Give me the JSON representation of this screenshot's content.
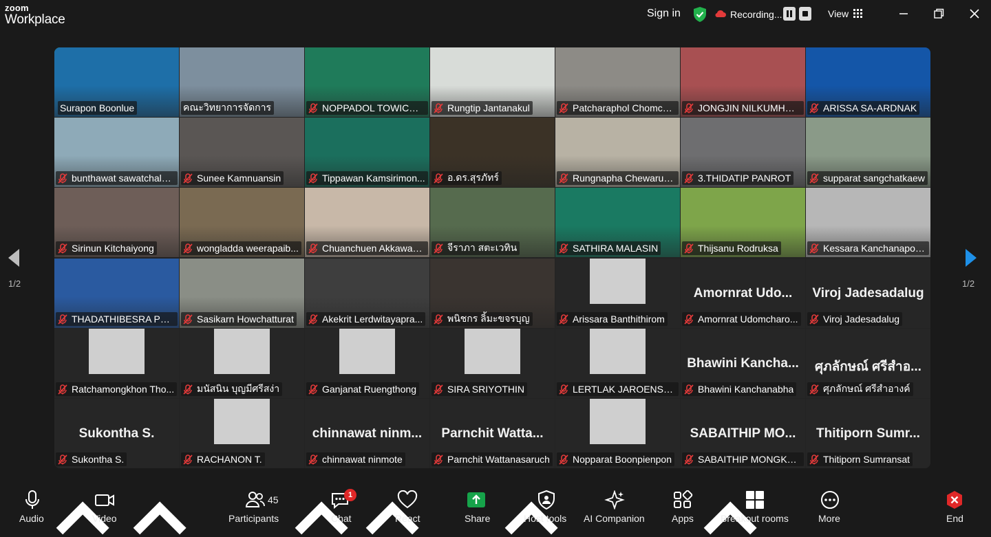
{
  "app": {
    "brand_top": "zoom",
    "brand_bottom": "Workplace"
  },
  "titlebar": {
    "signin": "Sign in",
    "recording": "Recording...",
    "view": "View"
  },
  "pager": {
    "left": "1/2",
    "right": "1/2"
  },
  "colors": {
    "active_border": "#3cd26e",
    "muted_mic": "#e23a3a",
    "share_green": "#16a34a",
    "end_red": "#e02828"
  },
  "tiles": [
    {
      "name": "Surapon Boonlue",
      "video": true,
      "active": true,
      "bg": "#1e6fa8"
    },
    {
      "name": "คณะวิทยาการจัดการ",
      "video": true,
      "muted": false,
      "bg": "#7d8f9e"
    },
    {
      "name": "NOPPADOL TOWICHAI...",
      "video": true,
      "muted": true,
      "bg": "#1f7b5a"
    },
    {
      "name": "Rungtip Jantanakul",
      "video": true,
      "muted": true,
      "bg": "#d8dcd8"
    },
    {
      "name": "Patcharaphol Chomch...",
      "video": true,
      "muted": true,
      "bg": "#8d8b86"
    },
    {
      "name": "JONGJIN NILKUMHAE...",
      "video": true,
      "muted": true,
      "bg": "#a85052"
    },
    {
      "name": "ARISSA SA-ARDNAK",
      "video": true,
      "muted": true,
      "bg": "#1456a8"
    },
    {
      "name": "bunthawat sawatchalo...",
      "video": true,
      "muted": true,
      "bg": "#8eaab8"
    },
    {
      "name": "Sunee Kamnuansin",
      "video": true,
      "muted": true,
      "bg": "#5a5654"
    },
    {
      "name": "Tippawan Kamsirimon...",
      "video": true,
      "muted": true,
      "bg": "#1b6f5d"
    },
    {
      "name": "อ.ดร.สุรภัทร์",
      "video": true,
      "muted": true,
      "bg": "#3b3226"
    },
    {
      "name": "Rungnapha Chewarus...",
      "video": true,
      "muted": true,
      "bg": "#b8b2a4"
    },
    {
      "name": "3.THIDATIP PANROT",
      "video": true,
      "muted": true,
      "bg": "#6e6e70"
    },
    {
      "name": "supparat sangchatkaew",
      "video": true,
      "muted": true,
      "bg": "#8a9a88"
    },
    {
      "name": "Sirinun Kitchaiyong",
      "video": true,
      "muted": true,
      "bg": "#6e5e58"
    },
    {
      "name": "wongladda weerapaib...",
      "video": true,
      "muted": true,
      "bg": "#7a6a52"
    },
    {
      "name": "Chuanchuen Akkawan...",
      "video": true,
      "muted": true,
      "bg": "#c8b8a8"
    },
    {
      "name": "จีราภา สตะเวทิน",
      "video": true,
      "muted": true,
      "bg": "#566b4e"
    },
    {
      "name": "SATHIRA MALASIN",
      "video": true,
      "muted": true,
      "bg": "#1a7a62"
    },
    {
      "name": "Thijsanu Rodruksa",
      "video": true,
      "muted": true,
      "bg": "#7ea54a"
    },
    {
      "name": "Kessara Kanchanapoom",
      "video": true,
      "muted": true,
      "bg": "#b7b7b7"
    },
    {
      "name": "THADATHIBESRA PHU...",
      "video": true,
      "muted": true,
      "bg": "#2a5aa0"
    },
    {
      "name": "Sasikarn Howchatturat",
      "video": true,
      "muted": true,
      "bg": "#8a8e86"
    },
    {
      "name": "Akekrit Lerdwitayapra...",
      "video": true,
      "muted": true,
      "bg": "#3e3e3e"
    },
    {
      "name": "พนิชกร ลิ้มะขจรบุญ",
      "video": true,
      "muted": true,
      "bg": "#3a3430"
    },
    {
      "name": "Arissara Banthithirom",
      "video": false,
      "photo": true,
      "muted": true
    },
    {
      "name": "Amornrat Udomcharo...",
      "video": false,
      "display": "Amornrat Udo...",
      "muted": true
    },
    {
      "name": "Viroj Jadesadalug",
      "video": false,
      "display": "Viroj Jadesadalug",
      "muted": true
    },
    {
      "name": "Ratchamongkhon Tho...",
      "video": false,
      "photo": true,
      "muted": true
    },
    {
      "name": "มนัสนิน บุญมีศรีสง่า",
      "video": false,
      "photo": true,
      "muted": true
    },
    {
      "name": "Ganjanat Ruengthong",
      "video": false,
      "photo": true,
      "muted": true
    },
    {
      "name": "SIRA SRIYOTHIN",
      "video": false,
      "photo": true,
      "muted": true
    },
    {
      "name": "LERTLAK JAROENSOM...",
      "video": false,
      "photo": true,
      "muted": true
    },
    {
      "name": "Bhawini Kanchanabha",
      "video": false,
      "display": "Bhawini Kancha...",
      "muted": true
    },
    {
      "name": "ศุภลักษณ์ ศรีสำอางค์",
      "video": false,
      "display": "ศุภลักษณ์ ศรีสำอ...",
      "muted": true
    },
    {
      "name": "Sukontha S.",
      "video": false,
      "display": "Sukontha S.",
      "muted": true
    },
    {
      "name": "RACHANON T.",
      "video": false,
      "photo": true,
      "muted": true
    },
    {
      "name": "chinnawat ninmote",
      "video": false,
      "display": "chinnawat ninm...",
      "muted": true
    },
    {
      "name": "Parnchit Wattanasaruch",
      "video": false,
      "display": "Parnchit Watta...",
      "muted": true
    },
    {
      "name": "Nopparat Boonpienpon",
      "video": false,
      "photo": true,
      "muted": true
    },
    {
      "name": "SABAITHIP MONGKOLI...",
      "video": false,
      "display": "SABAITHIP MO...",
      "muted": true
    },
    {
      "name": "Thitiporn Sumransat",
      "video": false,
      "display": "Thitiporn Sumr...",
      "muted": true
    }
  ],
  "toolbar": {
    "audio": "Audio",
    "video": "Video",
    "participants": "Participants",
    "participants_count": "45",
    "chat": "Chat",
    "chat_badge": "1",
    "react": "React",
    "share": "Share",
    "host_tools": "Host tools",
    "ai_companion": "AI Companion",
    "apps": "Apps",
    "breakout_rooms": "Breakout rooms",
    "more": "More",
    "end": "End"
  }
}
